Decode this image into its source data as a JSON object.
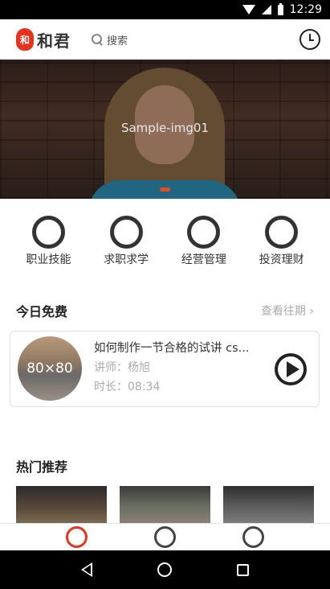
{
  "status_bar": {
    "time": "12:29"
  },
  "header": {
    "logo_mark": "和",
    "logo_text": "和君",
    "search_placeholder": "搜索"
  },
  "banner": {
    "caption": "Sample-img01"
  },
  "categories": [
    {
      "label": "职业技能"
    },
    {
      "label": "求职求学"
    },
    {
      "label": "经营管理"
    },
    {
      "label": "投资理财"
    }
  ],
  "free_today": {
    "title": "今日免费",
    "more_label": "查看往期",
    "course": {
      "thumb_label": "80×80",
      "title": "如何制作一节合格的试讲 cs...",
      "lecturer": "讲师：杨旭",
      "duration": "时长：08:34"
    }
  },
  "recommend": {
    "title": "热门推荐"
  },
  "colors": {
    "accent": "#e8321c",
    "text": "#333333",
    "muted": "#aaaaaa"
  }
}
